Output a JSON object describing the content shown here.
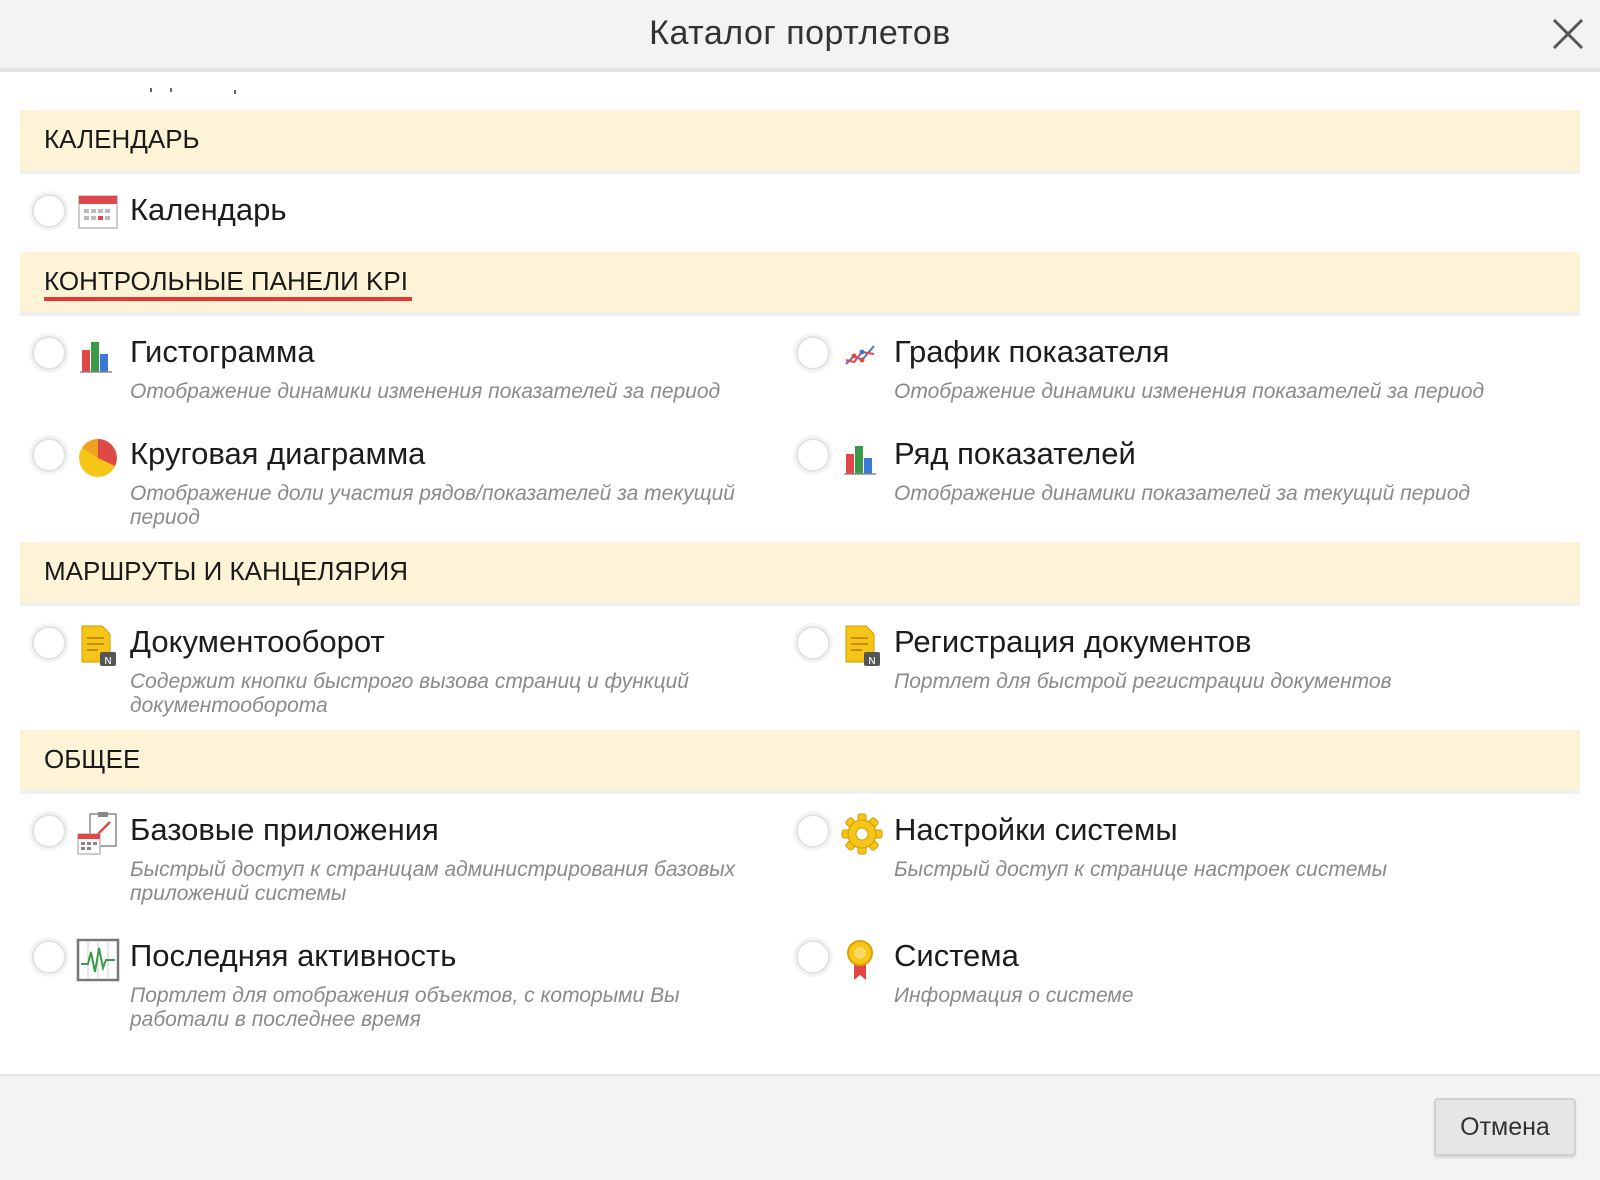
{
  "dialog": {
    "title": "Каталог портлетов",
    "close_icon": "close-icon"
  },
  "sections": {
    "calendar": {
      "title": "КАЛЕНДАРЬ",
      "items": [
        {
          "title": "Календарь",
          "icon": "calendar-icon"
        }
      ]
    },
    "kpi": {
      "title": "КОНТРОЛЬНЫЕ ПАНЕЛИ KPI",
      "underline_color": "#e53935",
      "items": [
        {
          "title": "Гистограмма",
          "desc": "Отображение динамики изменения показателей за период",
          "icon": "bar-chart-icon"
        },
        {
          "title": "График показателя",
          "desc": "Отображение динамики изменения показателей за период",
          "icon": "line-chart-icon"
        },
        {
          "title": "Круговая диаграмма",
          "desc": "Отображение доли участия рядов/показателей за текущий период",
          "icon": "pie-chart-icon"
        },
        {
          "title": "Ряд показателей",
          "desc": "Отображение динамики показателей за текущий период",
          "icon": "bar-chart-icon"
        }
      ]
    },
    "routes": {
      "title": "МАРШРУТЫ И КАНЦЕЛЯРИЯ",
      "items": [
        {
          "title": "Документооборот",
          "desc": "Содержит кнопки быстрого вызова страниц и функций документооборота",
          "icon": "document-lock-icon"
        },
        {
          "title": "Регистрация документов",
          "desc": "Портлет для быстрой регистрации документов",
          "icon": "document-lock-icon"
        }
      ]
    },
    "general": {
      "title": "ОБЩЕЕ",
      "items": [
        {
          "title": "Базовые приложения",
          "desc": "Быстрый доступ к страницам администрирования базовых приложений системы",
          "icon": "clipboard-calendar-icon"
        },
        {
          "title": "Настройки системы",
          "desc": "Быстрый доступ к странице настроек системы",
          "icon": "gear-icon"
        },
        {
          "title": "Последняя активность",
          "desc": "Портлет для отображения объектов, с которыми Вы работали в последнее время",
          "icon": "activity-monitor-icon"
        },
        {
          "title": "Система",
          "desc": "Информация о системе",
          "icon": "medal-icon"
        }
      ]
    }
  },
  "footer": {
    "cancel_label": "Отмена"
  },
  "colors": {
    "section_bg": "#fdf3d7",
    "header_bg": "#f3f3f3",
    "accent_red": "#e53935"
  }
}
